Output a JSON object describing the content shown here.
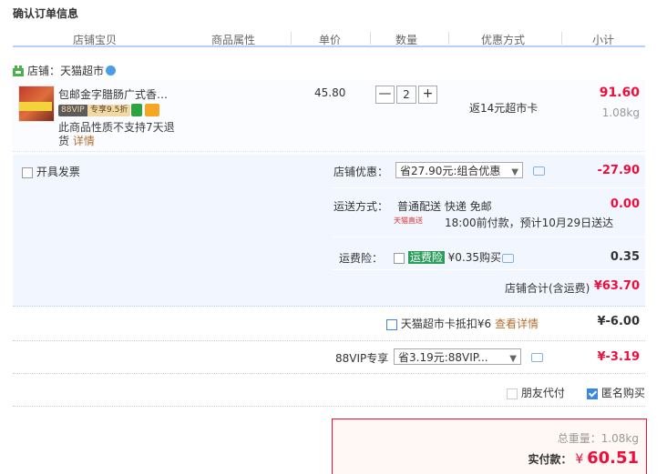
{
  "page": {
    "title": "确认订单信息"
  },
  "columns": [
    "店铺宝贝",
    "商品属性",
    "单价",
    "数量",
    "优惠方式",
    "小计"
  ],
  "shop": {
    "label": "店铺：天猫超市"
  },
  "item": {
    "title": "包邮金字腊肠广式香…",
    "vip_badge": "88VIP",
    "vip_price": "专享9.5折",
    "return_note": "此商品性质不支持7天退货",
    "return_link": "详情",
    "unit_price": "45.80",
    "qty_minus": "—",
    "quantity": "2",
    "qty_plus": "+",
    "promo": "返14元超市卡",
    "subtotal": "91.60",
    "weight": "1.08kg"
  },
  "invoice": {
    "label": "开具发票"
  },
  "store_discount": {
    "label": "店铺优惠：",
    "selected": "省27.90元:组合优惠",
    "amount": "-27.90"
  },
  "shipping": {
    "label": "运送方式：",
    "method": "普通配送 快递 免邮",
    "tag": "天猫直送",
    "eta": "18:00前付款，预计10月29日送达",
    "amount": "0.00"
  },
  "insurance": {
    "label": "运费险：",
    "tag": "运费险",
    "price": "¥0.35购买",
    "amount": "0.35"
  },
  "shop_total": {
    "label": "店铺合计(含运费)",
    "amount": "¥63.70"
  },
  "supermarket_card": {
    "label": "天猫超市卡抵扣¥6",
    "link": "查看详情",
    "amount": "¥-6.00"
  },
  "vip": {
    "label": "88VIP专享",
    "selected": "省3.19元:88VIP...",
    "amount": "¥-3.19"
  },
  "options": {
    "friend_pay": "朋友代付",
    "anonymous": "匿名购买"
  },
  "summary": {
    "weight_label": "总重量：",
    "weight": "1.08kg",
    "pay_label": "实付款：",
    "currency": "¥",
    "pay_amount": "60.51"
  },
  "colors": {
    "accent": "#f00d3a",
    "blue_bg": "#f2f7ff",
    "header_line": "#b2d1ff"
  }
}
